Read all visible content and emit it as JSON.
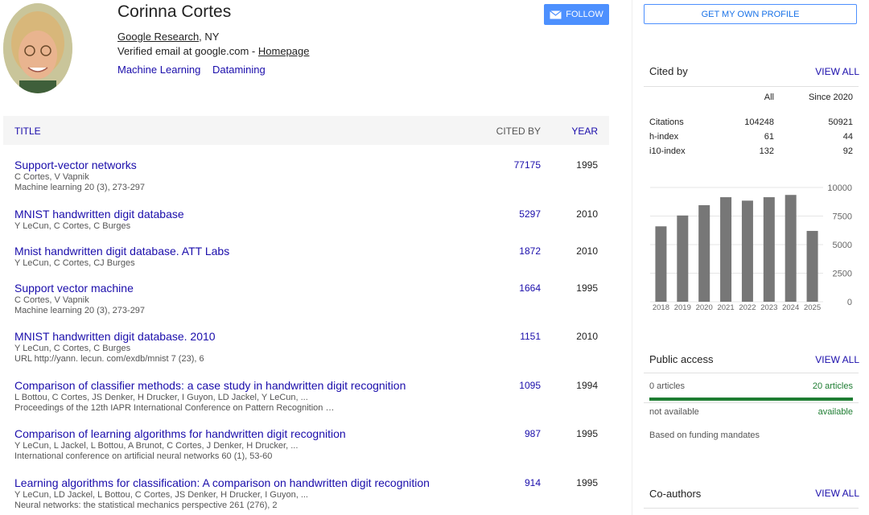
{
  "profile": {
    "name": "Corinna Cortes",
    "affiliation_link": "Google Research",
    "affiliation_rest": ", NY",
    "email_text": "Verified email at google.com - ",
    "homepage": "Homepage",
    "interests": [
      "Machine Learning",
      "Datamining"
    ],
    "follow_label": "FOLLOW"
  },
  "table": {
    "col_title": "TITLE",
    "col_cited": "CITED BY",
    "col_year": "YEAR",
    "rows": [
      {
        "title": "Support-vector networks",
        "authors": "C Cortes, V Vapnik",
        "venue": "Machine learning 20 (3), 273-297",
        "cites": "77175",
        "year": "1995"
      },
      {
        "title": "MNIST handwritten digit database",
        "authors": "Y LeCun, C Cortes, C Burges",
        "venue": "",
        "cites": "5297",
        "year": "2010"
      },
      {
        "title": "Mnist handwritten digit database. ATT Labs",
        "authors": "Y LeCun, C Cortes, CJ Burges",
        "venue": "",
        "cites": "1872",
        "year": "2010"
      },
      {
        "title": "Support vector machine",
        "authors": "C Cortes, V Vapnik",
        "venue": "Machine learning 20 (3), 273-297",
        "cites": "1664",
        "year": "1995"
      },
      {
        "title": "MNIST handwritten digit database. 2010",
        "authors": "Y LeCun, C Cortes, C Burges",
        "venue": "URL http://yann. lecun. com/exdb/mnist 7 (23), 6",
        "cites": "1151",
        "year": "2010"
      },
      {
        "title": "Comparison of classifier methods: a case study in handwritten digit recognition",
        "authors": "L Bottou, C Cortes, JS Denker, H Drucker, I Guyon, LD Jackel, Y LeCun, ...",
        "venue": "Proceedings of the 12th IAPR International Conference on Pattern Recognition …",
        "cites": "1095",
        "year": "1994"
      },
      {
        "title": "Comparison of learning algorithms for handwritten digit recognition",
        "authors": "Y LeCun, L Jackel, L Bottou, A Brunot, C Cortes, J Denker, H Drucker, ...",
        "venue": "International conference on artificial neural networks 60 (1), 53-60",
        "cites": "987",
        "year": "1995"
      },
      {
        "title": "Learning algorithms for classification: A comparison on handwritten digit recognition",
        "authors": "Y LeCun, LD Jackel, L Bottou, C Cortes, JS Denker, H Drucker, I Guyon, ...",
        "venue": "Neural networks: the statistical mechanics perspective 261 (276), 2",
        "cites": "914",
        "year": "1995"
      }
    ]
  },
  "sidebar": {
    "own_profile_label": "GET MY OWN PROFILE",
    "cited_by": {
      "title": "Cited by",
      "view_all": "VIEW ALL",
      "col_all": "All",
      "col_since": "Since 2020",
      "rows": [
        {
          "label": "Citations",
          "all": "104248",
          "since": "50921"
        },
        {
          "label": "h-index",
          "all": "61",
          "since": "44"
        },
        {
          "label": "i10-index",
          "all": "132",
          "since": "92"
        }
      ]
    },
    "public_access": {
      "title": "Public access",
      "view_all": "VIEW ALL",
      "left_count": "0 articles",
      "right_count": "20 articles",
      "left_status": "not available",
      "right_status": "available",
      "note": "Based on funding mandates",
      "available_fraction": 1.0
    },
    "coauthors": {
      "title": "Co-authors",
      "view_all": "VIEW ALL"
    }
  },
  "colors": {
    "link": "#1a0dab",
    "bar": "#777777",
    "available": "#1e7d32",
    "button": "#4d90fe"
  },
  "chart_data": {
    "type": "bar",
    "categories": [
      "2018",
      "2019",
      "2020",
      "2021",
      "2022",
      "2023",
      "2024",
      "2025"
    ],
    "values": [
      6600,
      7550,
      8450,
      9150,
      8850,
      9150,
      9350,
      6200
    ],
    "ylim": [
      0,
      10000
    ],
    "yticks": [
      "10000",
      "7500",
      "5000",
      "2500",
      "0"
    ],
    "ytick_values": [
      10000,
      7500,
      5000,
      2500,
      0
    ]
  }
}
